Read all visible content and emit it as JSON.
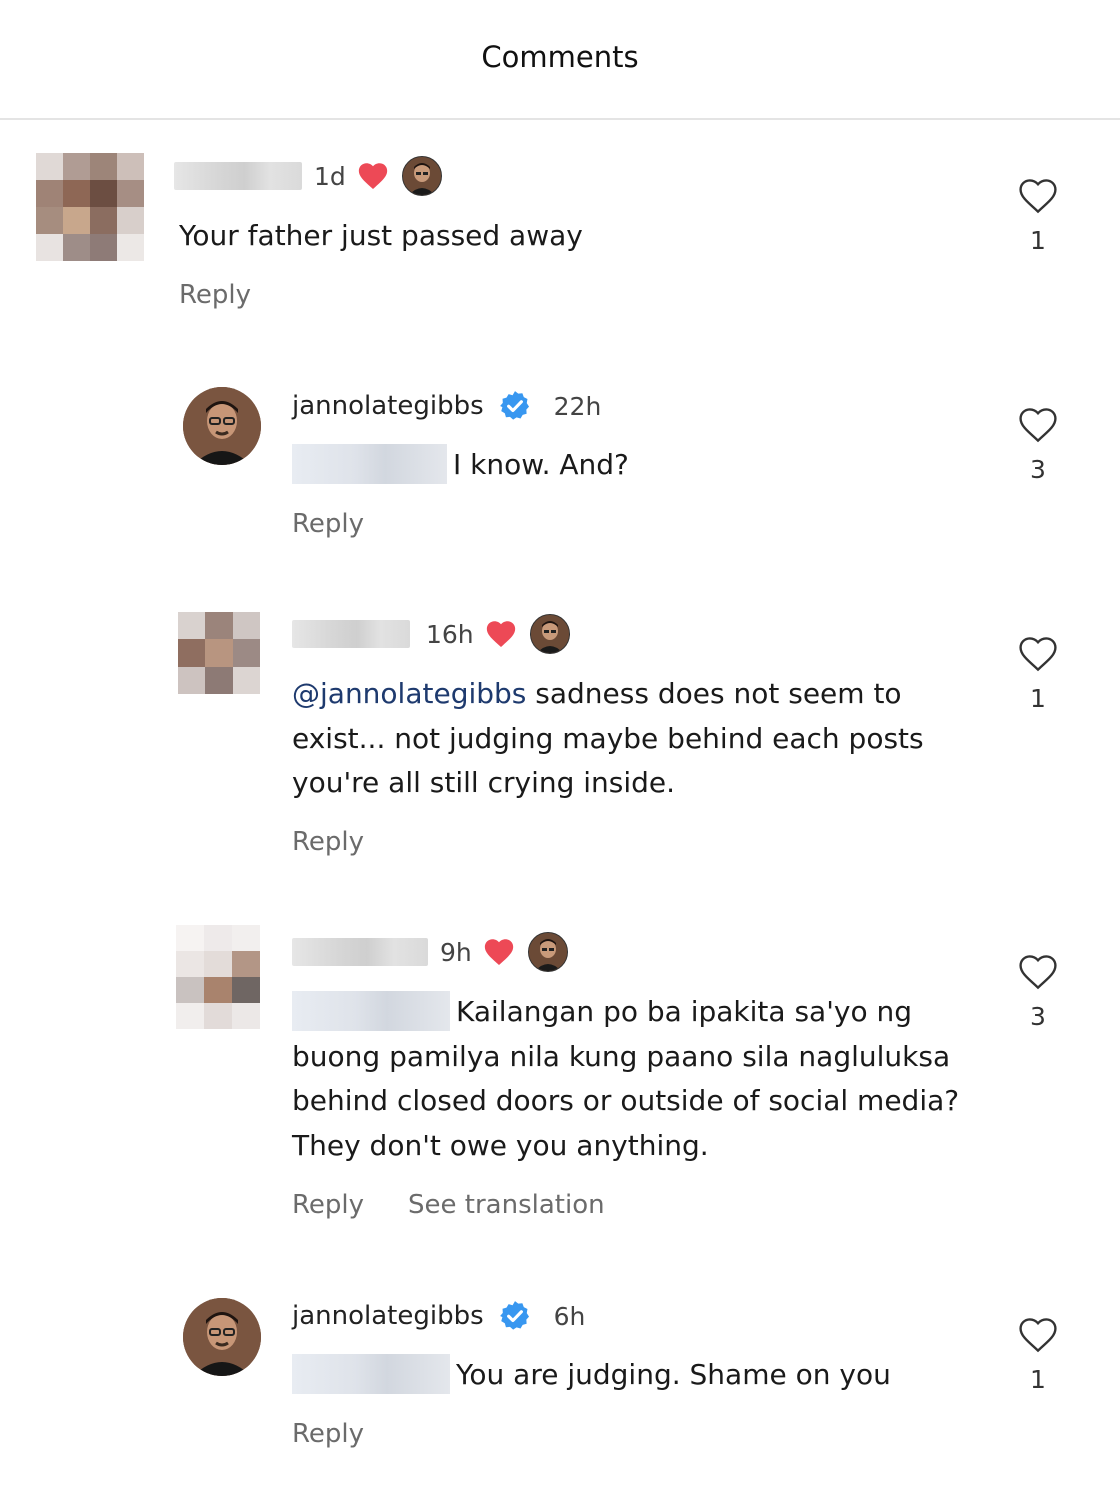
{
  "header": {
    "title": "Comments"
  },
  "comments": [
    {
      "time": "1d",
      "text": "Your father just passed away",
      "reply": "Reply",
      "likes": "1"
    },
    {
      "username": "jannolategibbs",
      "time": "22h",
      "text": "I know. And?",
      "reply": "Reply",
      "likes": "3"
    },
    {
      "time": "16h",
      "mention": "@jannolategibbs",
      "text": " sadness does not seem to exist... not judging maybe behind each posts you're all still crying inside.",
      "reply": "Reply",
      "likes": "1"
    },
    {
      "time": "9h",
      "text": "Kailangan po ba ipakita sa'yo ng buong pamilya nila kung paano sila nagluluksa behind closed doors or outside of social media? They don't owe you anything.",
      "reply": "Reply",
      "translate": "See translation",
      "likes": "3"
    },
    {
      "username": "jannolategibbs",
      "time": "6h",
      "text": "You are judging. Shame on you",
      "reply": "Reply",
      "likes": "1"
    }
  ],
  "colors": {
    "heart": "#ed4956",
    "verified": "#3897f0",
    "mention": "#1e3a6e"
  }
}
